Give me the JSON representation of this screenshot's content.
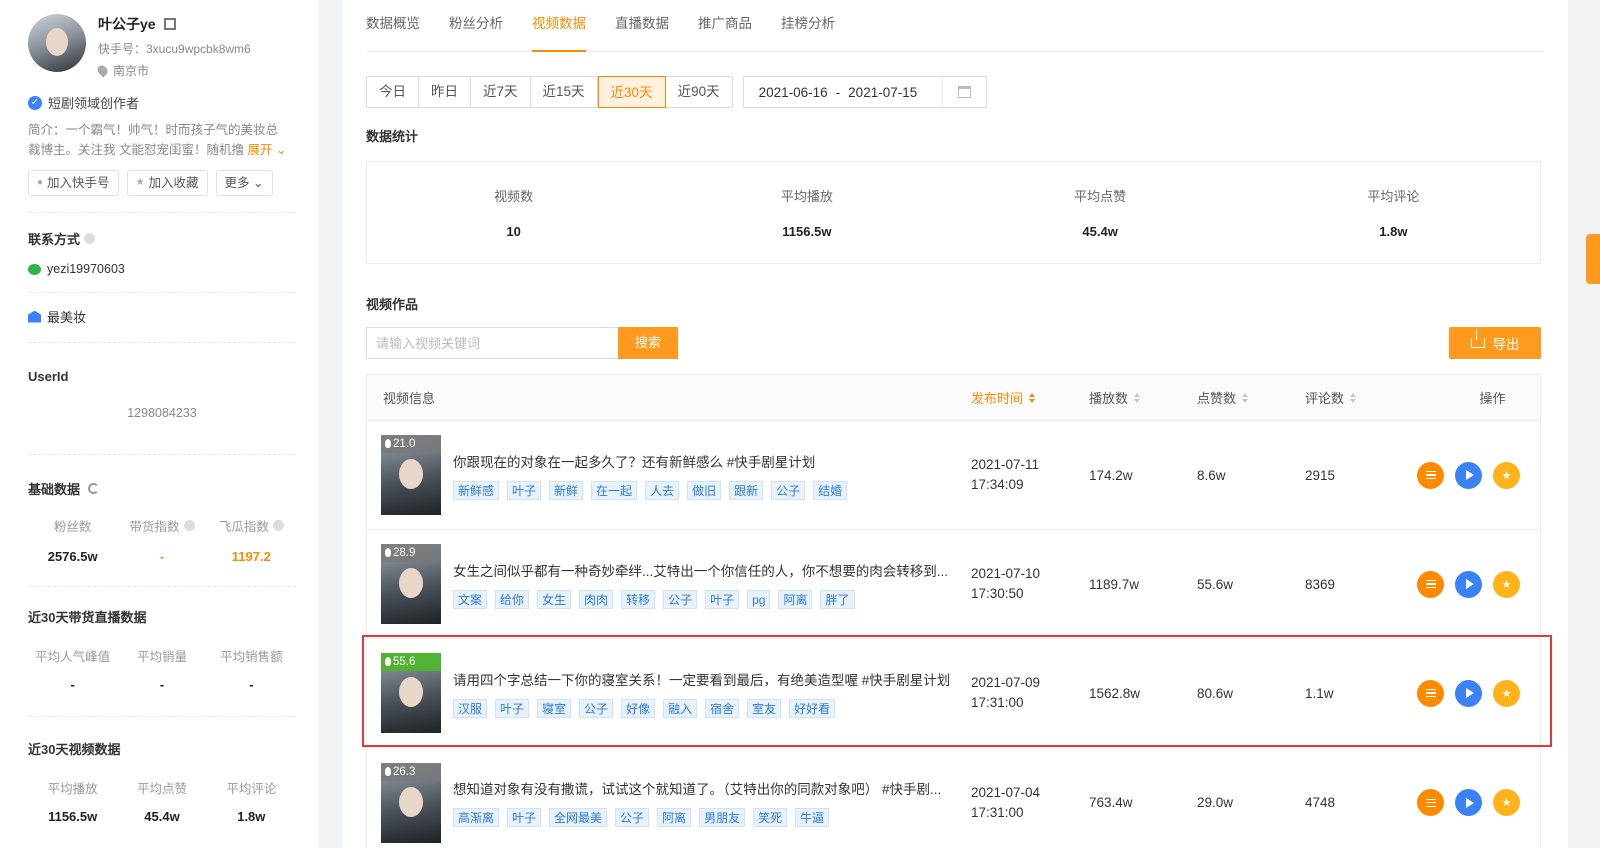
{
  "profile": {
    "nickname": "叶公子ye",
    "ks_id": "快手号：3xucu9wpcbk8wm6",
    "location": "南京市",
    "creator_label": "短剧领域创作者",
    "bio": "简介：一个霸气！帅气！时而孩子气的美妆总裁博主。关注我 文能怼宠闺蜜！随机撸",
    "expand": "展开",
    "buttons": {
      "add_ks": "加入快手号",
      "add_fav": "加入收藏",
      "more": "更多"
    }
  },
  "contact": {
    "title": "联系方式",
    "wechat": "yezi19970603"
  },
  "brand": {
    "name": "最美妆"
  },
  "userid": {
    "title": "UserId",
    "value": "1298084233"
  },
  "basic": {
    "title": "基础数据",
    "items": [
      {
        "label": "粉丝数",
        "value": "2576.5w"
      },
      {
        "label": "带货指数",
        "value": "-"
      },
      {
        "label": "飞瓜指数",
        "value": "1197.2"
      }
    ]
  },
  "live30": {
    "title": "近30天带货直播数据",
    "items": [
      {
        "label": "平均人气峰值",
        "value": "-"
      },
      {
        "label": "平均销量",
        "value": "-"
      },
      {
        "label": "平均销售额",
        "value": "-"
      }
    ]
  },
  "video30": {
    "title": "近30天视频数据",
    "items": [
      {
        "label": "平均播放",
        "value": "1156.5w"
      },
      {
        "label": "平均点赞",
        "value": "45.4w"
      },
      {
        "label": "平均评论",
        "value": "1.8w"
      }
    ]
  },
  "tabs": [
    "数据概览",
    "粉丝分析",
    "视频数据",
    "直播数据",
    "推广商品",
    "挂榜分析"
  ],
  "ranges": [
    "今日",
    "昨日",
    "近7天",
    "近15天",
    "近30天",
    "近90天"
  ],
  "date": {
    "start": "2021-06-16",
    "sep": "-",
    "end": "2021-07-15"
  },
  "stats": {
    "title": "数据统计",
    "items": [
      {
        "label": "视频数",
        "value": "10"
      },
      {
        "label": "平均播放",
        "value": "1156.5w"
      },
      {
        "label": "平均点赞",
        "value": "45.4w"
      },
      {
        "label": "平均评论",
        "value": "1.8w"
      }
    ]
  },
  "works": {
    "title": "视频作品",
    "search_placeholder": "请输入视频关键词",
    "search_btn": "搜索",
    "export_btn": "导出",
    "headers": {
      "info": "视频信息",
      "time": "发布时间",
      "play": "播放数",
      "like": "点赞数",
      "comment": "评论数",
      "op": "操作"
    },
    "rows": [
      {
        "heat": "21.0",
        "title": "你跟现在的对象在一起多久了？还有新鲜感么 #快手剧星计划",
        "tags": [
          "新鲜感",
          "叶子",
          "新鲜",
          "在一起",
          "人去",
          "做旧",
          "跟新",
          "公子",
          "结婚"
        ],
        "date": "2021-07-11",
        "time": "17:34:09",
        "play": "174.2w",
        "like": "8.6w",
        "comment": "2915"
      },
      {
        "heat": "28.9",
        "title": "女生之间似乎都有一种奇妙牵绊...艾特出一个你信任的人，你不想要的肉会转移到...",
        "tags": [
          "文案",
          "给你",
          "女生",
          "肉肉",
          "转移",
          "公子",
          "叶子",
          "pg",
          "阿离",
          "胖了"
        ],
        "date": "2021-07-10",
        "time": "17:30:50",
        "play": "1189.7w",
        "like": "55.6w",
        "comment": "8369"
      },
      {
        "heat": "55.6",
        "title": "请用四个字总结一下你的寝室关系！一定要看到最后，有绝美造型喔 #快手剧星计划",
        "tags": [
          "汉服",
          "叶子",
          "寝室",
          "公子",
          "好像",
          "融入",
          "宿舍",
          "室友",
          "好好看"
        ],
        "date": "2021-07-09",
        "time": "17:31:00",
        "play": "1562.8w",
        "like": "80.6w",
        "comment": "1.1w"
      },
      {
        "heat": "26.3",
        "title": "想知道对象有没有撒谎，试试这个就知道了。（艾特出你的同款对象吧） #快手剧...",
        "tags": [
          "高渐离",
          "叶子",
          "全网最美",
          "公子",
          "阿离",
          "男朋友",
          "笑死",
          "牛逼"
        ],
        "date": "2021-07-04",
        "time": "17:31:00",
        "play": "763.4w",
        "like": "29.0w",
        "comment": "4748"
      }
    ]
  },
  "colors": {
    "accent": "#ff8a00",
    "highlight": "#e53935",
    "tag": "#2f7bd6"
  }
}
